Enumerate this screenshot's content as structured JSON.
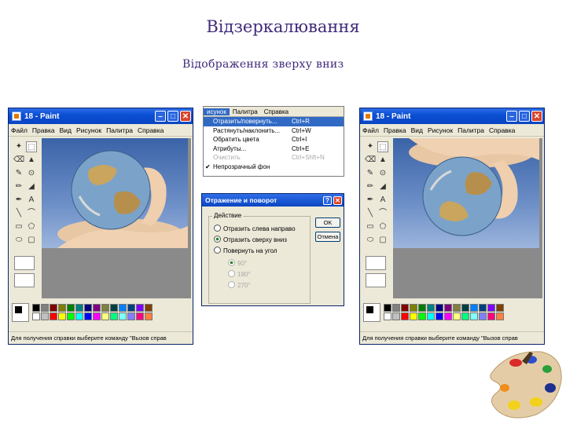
{
  "slide": {
    "title": "Відзеркалювання",
    "subtitle": "Відображення зверху вниз"
  },
  "windows": [
    {
      "title": "18 - Paint",
      "menu": [
        "Файл",
        "Правка",
        "Вид",
        "Рисунок",
        "Палитра",
        "Справка"
      ],
      "status": "Для получения справки выберите команду \"Вызов справ",
      "globe_orientation": "original"
    },
    {
      "title": "18 - Paint",
      "menu": [
        "Файл",
        "Правка",
        "Вид",
        "Рисунок",
        "Палитра",
        "Справка"
      ],
      "status": "Для получения справки выберите команду \"Вызов справ",
      "globe_orientation": "flipped-vertical"
    }
  ],
  "image_menu": {
    "bar": [
      "исунок",
      "Палитра",
      "Справка"
    ],
    "items": [
      {
        "label": "Отразить/повернуть...",
        "shortcut": "Ctrl+R",
        "state": "highlighted"
      },
      {
        "label": "Растянуть/наклонить...",
        "shortcut": "Ctrl+W",
        "state": "normal"
      },
      {
        "label": "Обратить цвета",
        "shortcut": "Ctrl+I",
        "state": "normal"
      },
      {
        "label": "Атрибуты...",
        "shortcut": "Ctrl+E",
        "state": "normal"
      },
      {
        "label": "Очистить",
        "shortcut": "Ctrl+Shft+N",
        "state": "disabled"
      },
      {
        "label": "Непрозрачный фон",
        "shortcut": "",
        "state": "checked"
      }
    ]
  },
  "flip_dialog": {
    "title": "Отражение и поворот",
    "group_label": "Действие",
    "options": [
      {
        "label": "Отразить слева направо",
        "selected": false,
        "enabled": true
      },
      {
        "label": "Отразить сверху вниз",
        "selected": true,
        "enabled": true
      },
      {
        "label": "Повернуть на угол",
        "selected": false,
        "enabled": true
      }
    ],
    "angles": [
      {
        "label": "90°",
        "selected": true
      },
      {
        "label": "180°",
        "selected": false
      },
      {
        "label": "270°",
        "selected": false
      }
    ],
    "ok_label": "OK",
    "cancel_label": "Отмена"
  },
  "palette_colors": [
    "#000000",
    "#808080",
    "#800000",
    "#808000",
    "#008000",
    "#008080",
    "#000080",
    "#800080",
    "#808040",
    "#004040",
    "#0080ff",
    "#004080",
    "#8000ff",
    "#804000",
    "#ffffff",
    "#c0c0c0",
    "#ff0000",
    "#ffff00",
    "#00ff00",
    "#00ffff",
    "#0000ff",
    "#ff00ff",
    "#ffff80",
    "#00ff80",
    "#80ffff",
    "#8080ff",
    "#ff0080",
    "#ff8040"
  ]
}
